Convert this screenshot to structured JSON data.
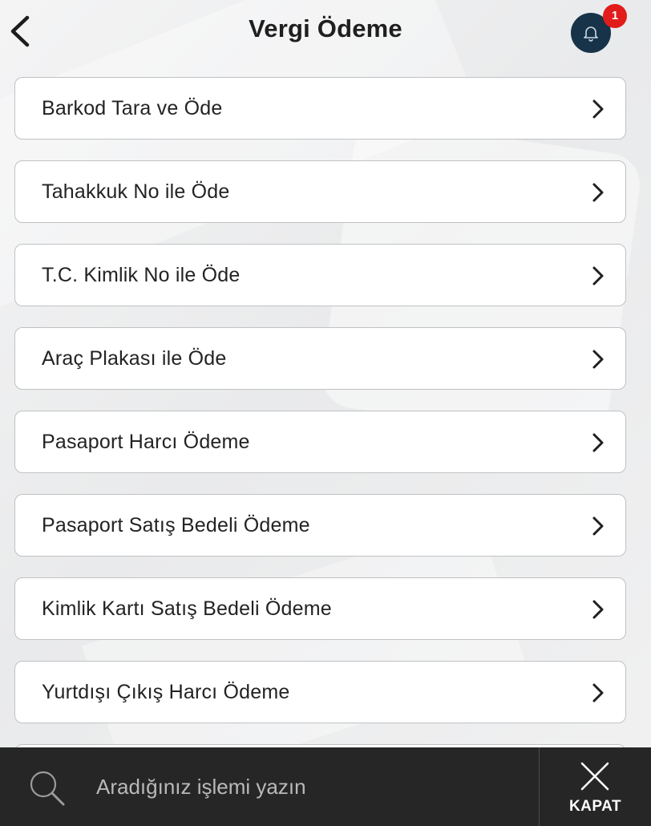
{
  "header": {
    "title": "Vergi Ödeme",
    "back_icon": "chevron-left-icon",
    "notification_icon": "bell-icon",
    "notification_count": "1",
    "colors": {
      "bell_bg": "#163349",
      "badge": "#e21b1b"
    }
  },
  "menu": {
    "items": [
      {
        "label": "Barkod Tara ve Öde"
      },
      {
        "label": "Tahakkuk No ile Öde"
      },
      {
        "label": "T.C. Kimlik No ile Öde"
      },
      {
        "label": "Araç Plakası ile Öde"
      },
      {
        "label": "Pasaport Harcı Ödeme"
      },
      {
        "label": "Pasaport Satış Bedeli Ödeme"
      },
      {
        "label": "Kimlik Kartı Satış Bedeli Ödeme"
      },
      {
        "label": "Yurtdışı Çıkış Harcı Ödeme"
      }
    ],
    "chevron_icon": "chevron-right-icon"
  },
  "bottom_bar": {
    "search_placeholder": "Aradığınız işlemi yazın",
    "search_icon": "search-icon",
    "close_label": "KAPAT",
    "close_icon": "close-icon",
    "colors": {
      "background": "#262626"
    }
  }
}
